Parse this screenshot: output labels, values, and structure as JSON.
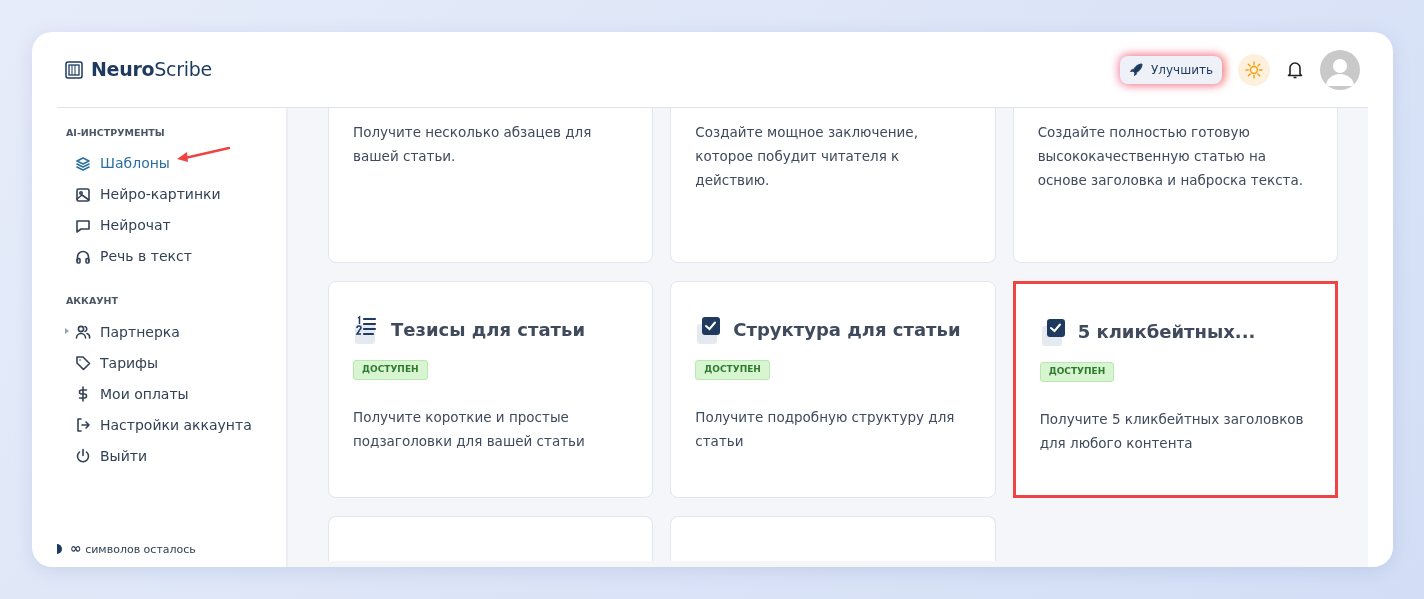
{
  "logo": {
    "bold": "Neuro",
    "rest": "Scribe"
  },
  "header": {
    "upgrade": "Улучшить"
  },
  "sidebar": {
    "sections": [
      {
        "title": "AI-ИНСТРУМЕНТЫ",
        "items": [
          {
            "label": "Шаблоны",
            "selected": true,
            "pointed": true
          },
          {
            "label": "Нейро-картинки",
            "selected": false,
            "pointed": false
          },
          {
            "label": "Нейрочат",
            "selected": false,
            "pointed": false
          },
          {
            "label": "Речь в текст",
            "selected": false,
            "pointed": false
          }
        ]
      },
      {
        "title": "АККАУНТ",
        "items": [
          {
            "label": "Партнерка",
            "selected": false,
            "pointed": false,
            "expandable": true
          },
          {
            "label": "Тарифы",
            "selected": false,
            "pointed": false,
            "expandable": false
          },
          {
            "label": "Мои оплаты",
            "selected": false,
            "pointed": false,
            "expandable": false
          },
          {
            "label": "Настройки аккаунта",
            "selected": false,
            "pointed": false,
            "expandable": false
          },
          {
            "label": "Выйти",
            "selected": false,
            "pointed": false,
            "expandable": false
          }
        ]
      }
    ],
    "credits": "∞",
    "credits_label": "символов осталось"
  },
  "cards": [
    {
      "kind": "cut-top",
      "description": "Получите несколько абзацев для вашей статьи."
    },
    {
      "kind": "cut-top",
      "description": "Создайте мощное заключение, которое побудит читателя к действию."
    },
    {
      "kind": "cut-top",
      "description": "Создайте полностью готовую высококачественную статью на основе заголовка и наброска текста."
    },
    {
      "kind": "numbered",
      "title": "Тезисы для статьи",
      "badge": "ДОСТУПЕН",
      "description": "Получите короткие и простые подзаголовки для вашей статьи",
      "highlighted": false
    },
    {
      "kind": "checked",
      "title": "Структура для статьи",
      "badge": "ДОСТУПЕН",
      "description": "Получите подробную структуру для статьи",
      "highlighted": false
    },
    {
      "kind": "checked",
      "title": "5 кликбейтных...",
      "badge": "ДОСТУПЕН",
      "description": "Получите 5 кликбейтных заголовков для любого контента",
      "highlighted": true
    },
    {
      "kind": "cut-bottom"
    },
    {
      "kind": "cut-bottom"
    }
  ]
}
